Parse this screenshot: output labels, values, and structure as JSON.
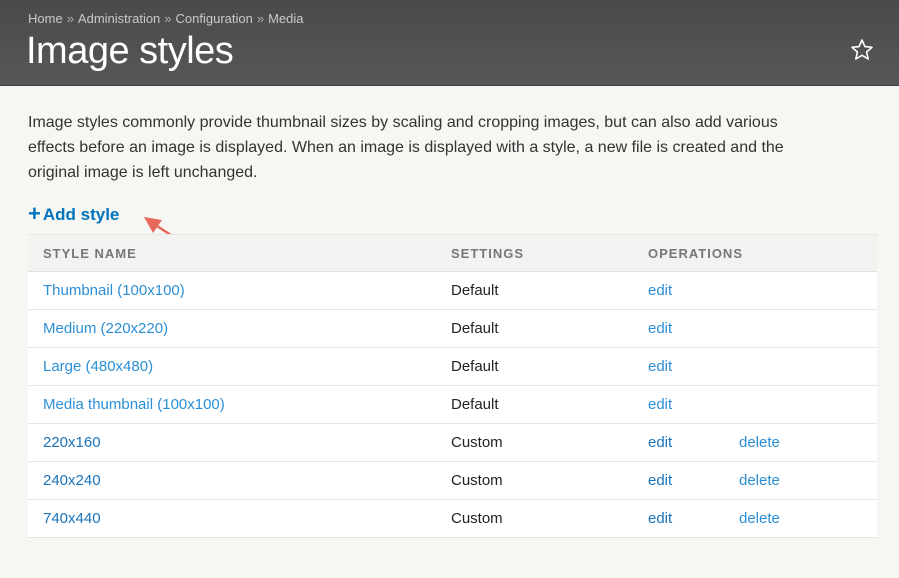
{
  "breadcrumb": {
    "items": [
      "Home",
      "Administration",
      "Configuration",
      "Media"
    ],
    "separator": "»"
  },
  "header": {
    "title": "Image styles",
    "favorite_icon": "star-outline-icon"
  },
  "description": "Image styles commonly provide thumbnail sizes by scaling and cropping images, but can also add various effects before an image is displayed. When an image is displayed with a style, a new file is created and the original image is left unchanged.",
  "actions": {
    "add_style_plus": "+",
    "add_style_label": "Add style"
  },
  "table": {
    "columns": {
      "style_name": "STYLE NAME",
      "settings": "SETTINGS",
      "operations": "OPERATIONS"
    },
    "rows": [
      {
        "name": "Thumbnail (100x100)",
        "settings": "Default",
        "edit": "edit",
        "delete": ""
      },
      {
        "name": "Medium (220x220)",
        "settings": "Default",
        "edit": "edit",
        "delete": ""
      },
      {
        "name": "Large (480x480)",
        "settings": "Default",
        "edit": "edit",
        "delete": ""
      },
      {
        "name": "Media thumbnail (100x100)",
        "settings": "Default",
        "edit": "edit",
        "delete": ""
      },
      {
        "name": "220x160",
        "settings": "Custom",
        "edit": "edit",
        "delete": "delete"
      },
      {
        "name": "240x240",
        "settings": "Custom",
        "edit": "edit",
        "delete": "delete"
      },
      {
        "name": "740x440",
        "settings": "Custom",
        "edit": "edit",
        "delete": "delete"
      }
    ]
  },
  "colors": {
    "header_bg": "#545454",
    "link": "#0074bd",
    "annotation_arrow": "#e8685a"
  }
}
